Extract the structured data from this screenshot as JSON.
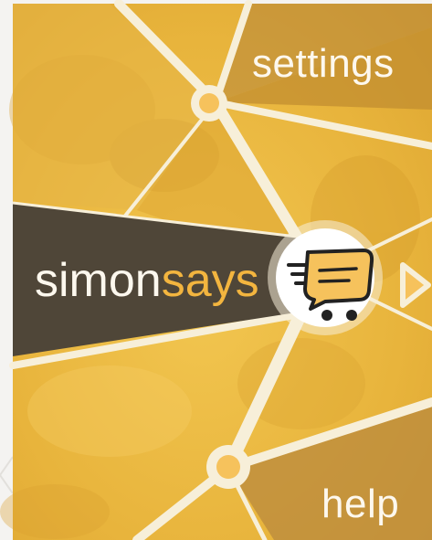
{
  "menu": {
    "settings_label": "settings",
    "help_label": "help",
    "title_part1": "simon",
    "title_part2": "says"
  },
  "icons": {
    "logo": "cart-chat-icon",
    "next": "arrow-right-icon"
  },
  "colors": {
    "mustard": "#e9b23a",
    "mustard_light": "#f1c75a",
    "mustard_dark": "#c8922a",
    "cream": "#fdf8ee",
    "dark_panel": "#4f4638",
    "accent_orange": "#f3b53f",
    "node_orange": "#f6c25c"
  }
}
